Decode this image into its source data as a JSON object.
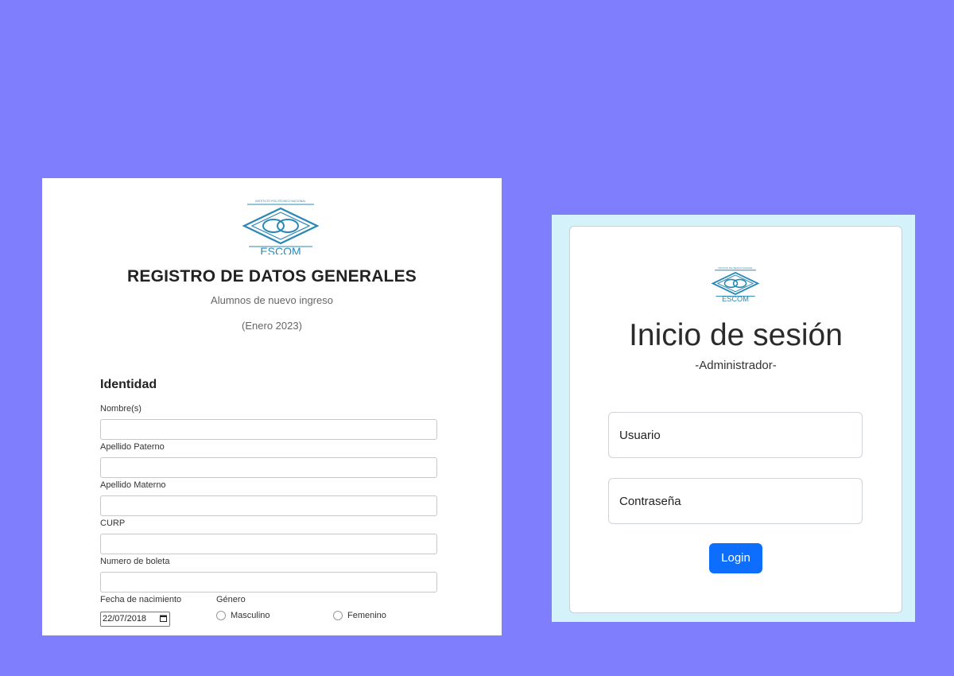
{
  "registration": {
    "logo": {
      "institute_text": "INSTITUTO POLITÉCNICO NACIONAL",
      "name": "ESCOM"
    },
    "title": "REGISTRO DE DATOS GENERALES",
    "subtitle": "Alumnos de nuevo ingreso",
    "period": "(Enero 2023)",
    "section_title": "Identidad",
    "fields": [
      {
        "label": "Nombre(s)",
        "value": ""
      },
      {
        "label": "Apellido Paterno",
        "value": ""
      },
      {
        "label": "Apellido Materno",
        "value": ""
      },
      {
        "label": "CURP",
        "value": ""
      },
      {
        "label": "Numero de boleta",
        "value": ""
      }
    ],
    "birthdate": {
      "label": "Fecha de nacimiento",
      "value": "22/07/2018",
      "icon": "calendar-icon"
    },
    "gender": {
      "label": "Género",
      "options": [
        {
          "label": "Masculino",
          "selected": false
        },
        {
          "label": "Femenino",
          "selected": false
        }
      ]
    }
  },
  "login": {
    "logo": {
      "institute_text": "INSTITUTO POLITÉCNICO NACIONAL",
      "name": "ESCOM"
    },
    "title": "Inicio de sesión",
    "role": "-Administrador-",
    "username_placeholder": "Usuario",
    "password_placeholder": "Contraseña",
    "button_label": "Login"
  },
  "colors": {
    "page_background": "#7f7ffe",
    "login_background": "#d4f2fa",
    "logo_blue": "#2b88b5",
    "button_blue": "#0d6efd"
  }
}
